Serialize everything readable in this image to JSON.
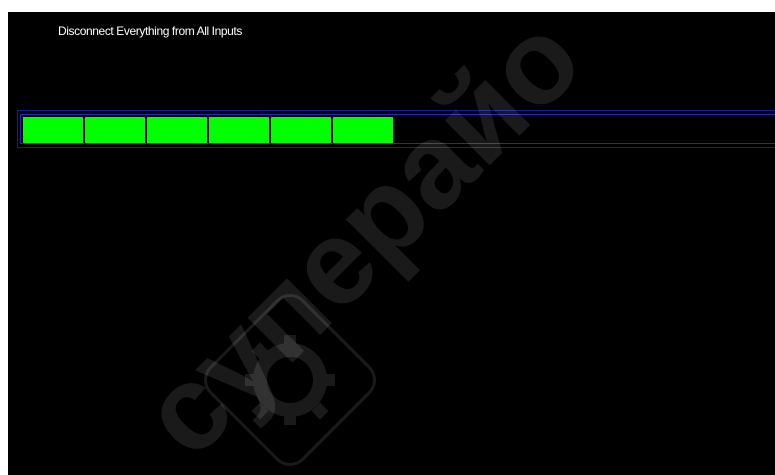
{
  "screen": {
    "title": "Disconnect Everything from All Inputs",
    "background_color": "#000000"
  },
  "progress": {
    "segments_filled": 6,
    "segment_color": "#00ff00",
    "border_color": "#2323c8"
  },
  "watermark": {
    "brand_text": "суперайо",
    "logo_icon": "gear-logo-icon"
  }
}
